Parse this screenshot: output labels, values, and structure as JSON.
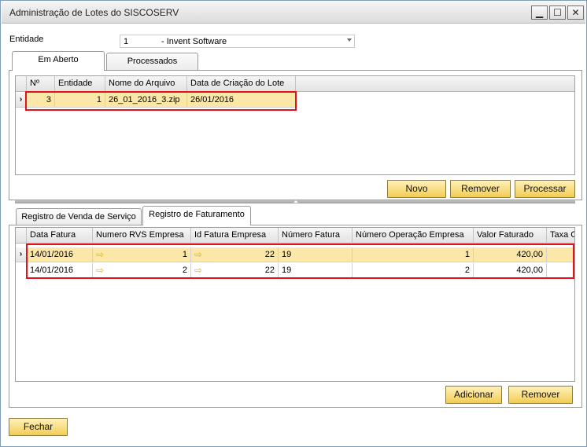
{
  "window": {
    "title": "Administração de Lotes do SISCOSERV",
    "minimize_glyph": "▁",
    "maximize_glyph": "☐",
    "close_glyph": "✕"
  },
  "entity": {
    "label": "Entidade",
    "code": "1",
    "name": "- Invent Software"
  },
  "top_tabs": [
    {
      "label": "Em Aberto",
      "active": true
    },
    {
      "label": "Processados",
      "active": false
    }
  ],
  "lots_grid": {
    "headers": [
      "Nº",
      "Entidade",
      "Nome do Arquivo",
      "Data de Criação do Lote"
    ],
    "rows": [
      {
        "numero": "3",
        "entidade": "1",
        "arquivo": "26_01_2016_3.zip",
        "data": "26/01/2016"
      }
    ]
  },
  "lot_buttons": {
    "new": "Novo",
    "remove": "Remover",
    "process": "Processar"
  },
  "bottom_tabs": [
    {
      "label": "Registro de Venda de Serviço",
      "active": false
    },
    {
      "label": "Registro de Faturamento",
      "active": true
    }
  ],
  "billing_grid": {
    "headers": [
      "Data Fatura",
      "Numero RVS Empresa",
      "Id Fatura Empresa",
      "Número Fatura",
      "Número Operação Empresa",
      "Valor Faturado",
      "Taxa C"
    ],
    "link_icon": "⇨",
    "rows": [
      {
        "data": "14/01/2016",
        "rvs": "1",
        "id_fatura": "22",
        "num_fatura": "19",
        "num_operacao": "1",
        "valor": "420,00",
        "taxa": ""
      },
      {
        "data": "14/01/2016",
        "rvs": "2",
        "id_fatura": "22",
        "num_fatura": "19",
        "num_operacao": "2",
        "valor": "420,00",
        "taxa": ""
      }
    ]
  },
  "billing_buttons": {
    "add": "Adicionar",
    "remove": "Remover"
  },
  "footer": {
    "close": "Fechar"
  },
  "row_indicator": "›",
  "colors": {
    "highlight_border": "#e0121b",
    "selected_row": "#fbe7a8",
    "button_gold": "#f2cc55"
  }
}
